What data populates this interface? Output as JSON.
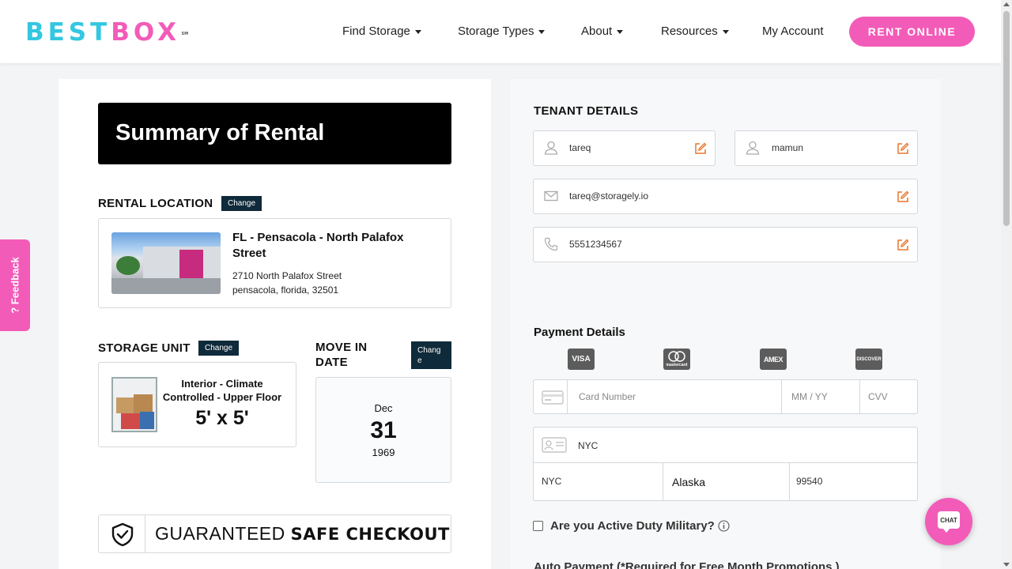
{
  "brand": {
    "logo_left": "BEST",
    "logo_right": "BOX",
    "logo_mark": "SM"
  },
  "nav": {
    "items": [
      {
        "label": "Find Storage",
        "dropdown": true
      },
      {
        "label": "Storage Types",
        "dropdown": true
      },
      {
        "label": "About",
        "dropdown": true
      },
      {
        "label": "Resources",
        "dropdown": true
      },
      {
        "label": "My Account",
        "dropdown": false
      }
    ],
    "cta": "RENT ONLINE"
  },
  "colors": {
    "brand_cyan": "#33c7e0",
    "brand_pink": "#f25cb8",
    "change_button": "#0f2a3a",
    "edit_icon": "#e8772e"
  },
  "summary": {
    "title": "Summary of Rental",
    "rental_location": {
      "label": "RENTAL LOCATION",
      "change_label": "Change",
      "name": "FL - Pensacola - North Palafox Street",
      "address_line1": "2710 North Palafox Street",
      "address_line2": "pensacola, florida, 32501"
    },
    "storage_unit": {
      "label": "STORAGE UNIT",
      "change_label": "Change",
      "name": "Interior - Climate Controlled - Upper Floor",
      "size": "5' x 5'"
    },
    "move_in": {
      "label_line1": "MOVE IN",
      "label_line2": "DATE",
      "change_line1": "Chang",
      "change_line2": "e",
      "month": "Dec",
      "day": "31",
      "year": "1969"
    },
    "guarantee": {
      "light": "GUARANTEED ",
      "bold": "SAFE CHECKOUT"
    }
  },
  "tenant": {
    "title": "TENANT DETAILS",
    "first_name": "tareq",
    "last_name": "mamun",
    "email": "tareq@storagely.io",
    "phone": "5551234567"
  },
  "payment": {
    "title": "Payment Details",
    "card_brands": [
      "VISA",
      "mastercard",
      "AMEX",
      "DISCOVER"
    ],
    "card_number_placeholder": "Card Number",
    "expiry_placeholder": "MM / YY",
    "cvv_placeholder": "CVV",
    "address": "NYC",
    "city": "NYC",
    "state": "Alaska",
    "zip": "99540"
  },
  "military": {
    "label": "Are you Active Duty Military?"
  },
  "autopay": {
    "label": "Auto Payment (*Required for Free Month Promotions )"
  },
  "feedback": {
    "label": "? Feedback"
  },
  "chat": {
    "label": "CHAT"
  }
}
